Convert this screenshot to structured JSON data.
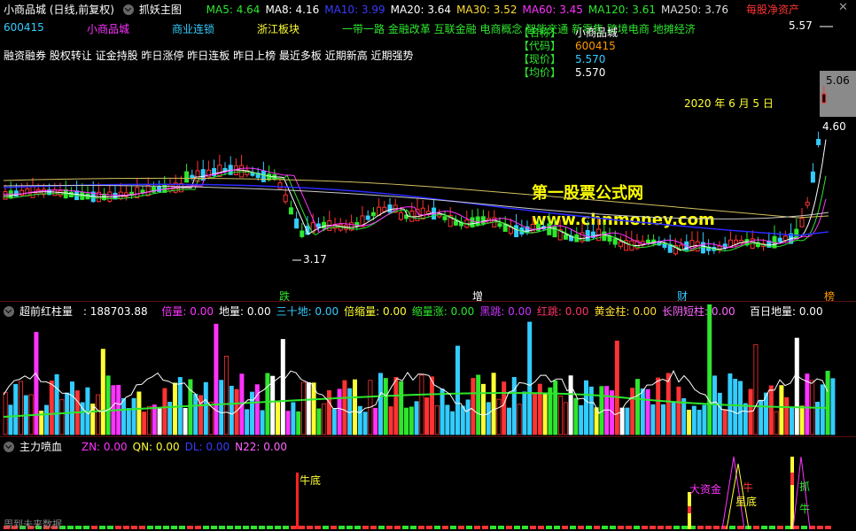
{
  "header": {
    "stock_title": "小商品城 (日线,前复权)",
    "indicator_name": "抓妖主图",
    "ma": [
      {
        "label": "MA5: 4.64",
        "color": "#2ee62e"
      },
      {
        "label": "MA8: 4.16",
        "color": "#ffffff"
      },
      {
        "label": "MA10: 3.99",
        "color": "#3a3aff"
      },
      {
        "label": "MA20: 3.64",
        "color": "#ffffff"
      },
      {
        "label": "MA30: 3.52",
        "color": "#ffdd33"
      },
      {
        "label": "MA60: 3.45",
        "color": "#ff33ff"
      },
      {
        "label": "MA120: 3.61",
        "color": "#2ee62e"
      },
      {
        "label": "MA250: 3.76",
        "color": "#dddddd"
      }
    ],
    "net_asset": "每股净资产",
    "close_icon": "x-icon"
  },
  "info": {
    "code": "600415",
    "name": "小商品城",
    "sector1": "商业连锁",
    "sector2": "浙江板块",
    "concepts": "一带一路 金融改革 互联金融 电商概念 智能交通 新零售 跨境电商 地摊经济",
    "tags": "融资融券 股权转让 证金持股 昨日涨停 昨日连板 昨日上榜 最近多板 近期新高 近期强势",
    "box": [
      {
        "k": "【名称】",
        "v": "小商品城",
        "vc": "#ffffff"
      },
      {
        "k": "【代码】",
        "v": "600415",
        "vc": "#ff9900"
      },
      {
        "k": "【现价】",
        "v": "5.570",
        "vc": "#33ccff"
      },
      {
        "k": "【均价】",
        "v": "5.570",
        "vc": "#ffffff"
      }
    ],
    "date": "2020 年 6 月 5 日"
  },
  "watermark": {
    "cn": "第一股票公式网",
    "url": "www.chnmoney.com"
  },
  "price_axis": {
    "top": "5.57",
    "box": "5.06",
    "mid": "4.60",
    "low_mark": "3.17"
  },
  "event_labels": [
    {
      "t": "跌",
      "c": "#2ee62e"
    },
    {
      "t": "增",
      "c": "#ffffff"
    },
    {
      "t": "财",
      "c": "#33ccff"
    },
    {
      "t": "榜",
      "c": "#ff9900"
    }
  ],
  "volume_panel": {
    "title": "超前红柱量",
    "value": ": 188703.88",
    "items": [
      {
        "label": "倍量: 0.00",
        "color": "#ff33ff"
      },
      {
        "label": "地量: 0.00",
        "color": "#ffffff"
      },
      {
        "label": "三十地: 0.00",
        "color": "#33ccff"
      },
      {
        "label": "倍缩量: 0.00",
        "color": "#ffff33"
      },
      {
        "label": "缩量涨: 0.00",
        "color": "#2ee62e"
      },
      {
        "label": "黑跳: 0.00",
        "color": "#cc33ff"
      },
      {
        "label": "红跳: 0.00",
        "color": "#ff3366"
      },
      {
        "label": "黄金柱: 0.00",
        "color": "#ffdd33"
      },
      {
        "label": "长阴短柱: 0.00",
        "color": "#ff66ff"
      }
    ],
    "hundred_day": "百日地量: 0.00"
  },
  "main_panel": {
    "title": "主力喷血",
    "items": [
      {
        "label": "ZN: 0.00",
        "color": "#ff33ff"
      },
      {
        "label": "QN: 0.00",
        "color": "#ffff33"
      },
      {
        "label": "DL: 0.00",
        "color": "#3a3aff"
      },
      {
        "label": "N22: 0.00",
        "color": "#ff66ff"
      }
    ],
    "marks": [
      {
        "t": "牛底",
        "c": "#ffff33"
      },
      {
        "t": "大资金",
        "c": "#ff33ff"
      },
      {
        "t": "星底",
        "c": "#ffff33"
      },
      {
        "t": "牛",
        "c": "#ff3333"
      },
      {
        "t": "抓",
        "c": "#2ee62e"
      },
      {
        "t": "牛",
        "c": "#2ee62e"
      }
    ],
    "footer": "周到未来数据"
  }
}
